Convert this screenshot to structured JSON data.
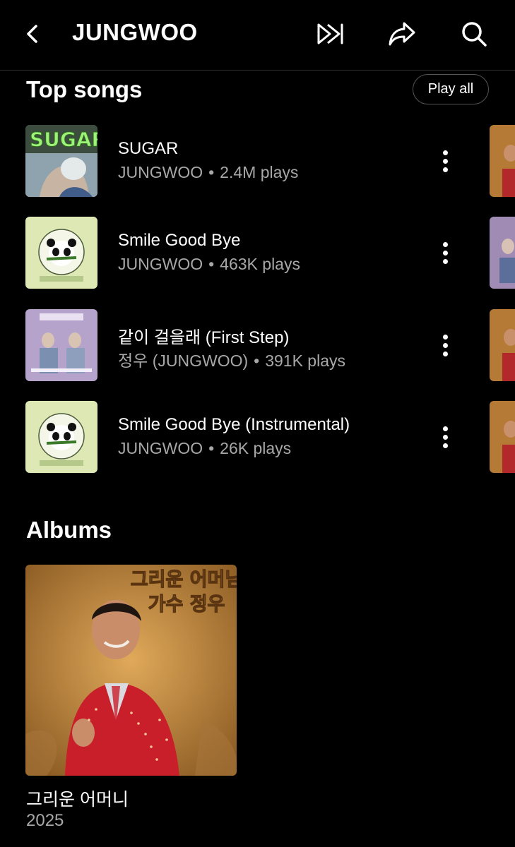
{
  "header": {
    "title": "JUNGWOO",
    "back_icon": "chevron-left-icon",
    "actions": [
      "play-next-icon",
      "share-icon",
      "search-icon"
    ]
  },
  "top_songs": {
    "title": "Top songs",
    "play_all_label": "Play all",
    "songs": [
      {
        "title": "SUGAR",
        "artist": "JUNGWOO",
        "plays": "2.4M plays"
      },
      {
        "title": "Smile Good Bye",
        "artist": "JUNGWOO",
        "plays": "463K plays"
      },
      {
        "title": "같이 걸을래 (First Step)",
        "artist": "정우 (JUNGWOO)",
        "plays": "391K plays"
      },
      {
        "title": "Smile Good Bye (Instrumental)",
        "artist": "JUNGWOO",
        "plays": "26K plays"
      }
    ]
  },
  "albums": {
    "title": "Albums",
    "items": [
      {
        "title": "그리운 어머니",
        "year": "2025",
        "cover_line1": "그리운 어머님",
        "cover_line2": "가수 정우"
      }
    ]
  },
  "art": {
    "sugar_text": "SUGAR"
  },
  "colors": {
    "background": "#000000",
    "secondary_text": "#a8a8a8",
    "divider": "#2a2a2a"
  }
}
